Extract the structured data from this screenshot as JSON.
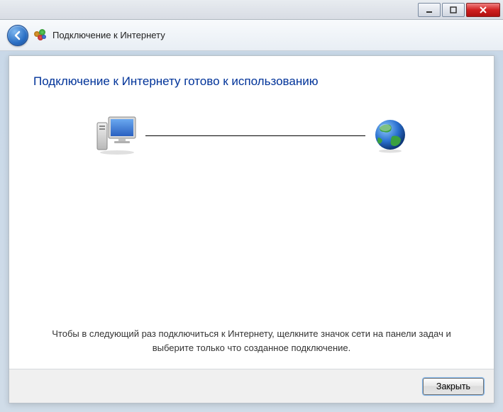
{
  "titlebar": {
    "minimize": "Свернуть",
    "maximize": "Развернуть",
    "close": "Закрыть"
  },
  "header": {
    "back_label": "Назад",
    "wizard_title": "Подключение к Интернету"
  },
  "main": {
    "heading": "Подключение к Интернету готово к использованию",
    "computer_alt": "Компьютер",
    "internet_alt": "Интернет",
    "hint": "Чтобы в следующий раз подключиться к Интернету, щелкните значок сети на панели задач и выберите только что созданное подключение."
  },
  "footer": {
    "close_label": "Закрыть"
  }
}
